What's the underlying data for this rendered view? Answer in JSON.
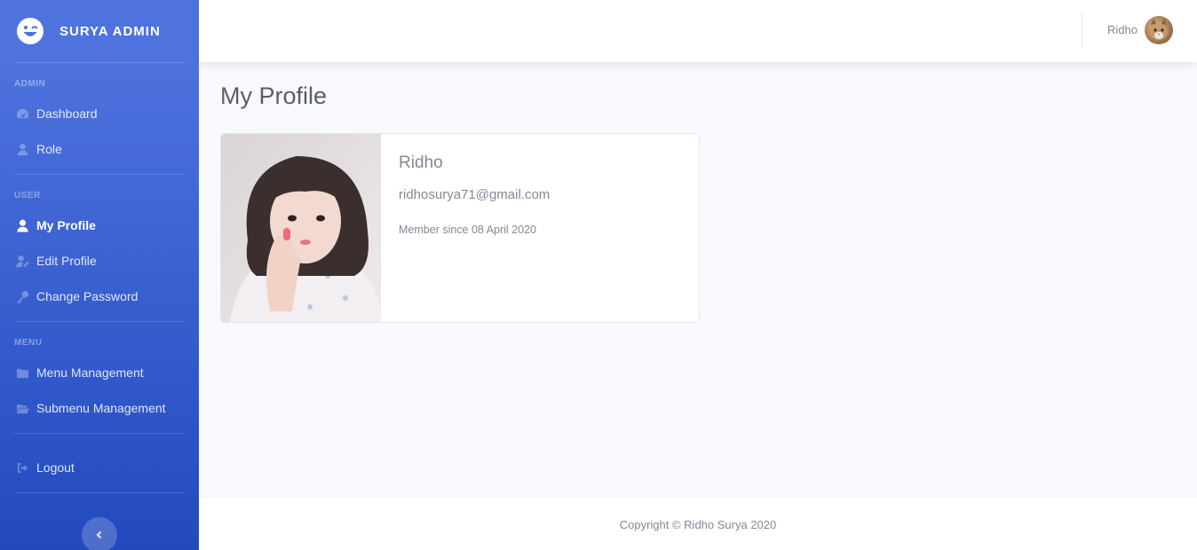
{
  "brand": {
    "name": "SURYA ADMIN",
    "icon": "laugh-wink-icon"
  },
  "sidebar": {
    "sections": [
      {
        "heading": "ADMIN",
        "items": [
          {
            "label": "Dashboard",
            "icon": "tachometer-icon"
          },
          {
            "label": "Role",
            "icon": "user-tie-icon"
          }
        ]
      },
      {
        "heading": "USER",
        "items": [
          {
            "label": "My Profile",
            "icon": "user-icon",
            "active": true
          },
          {
            "label": "Edit Profile",
            "icon": "user-edit-icon"
          },
          {
            "label": "Change Password",
            "icon": "key-icon"
          }
        ]
      },
      {
        "heading": "MENU",
        "items": [
          {
            "label": "Menu Management",
            "icon": "folder-icon"
          },
          {
            "label": "Submenu Management",
            "icon": "folder-open-icon"
          }
        ]
      }
    ],
    "logout": {
      "label": "Logout",
      "icon": "sign-out-icon"
    },
    "toggle_icon": "chevron-left-icon"
  },
  "topbar": {
    "user_name": "Ridho"
  },
  "page": {
    "title": "My Profile"
  },
  "profile": {
    "name": "Ridho",
    "email": "ridhosurya71@gmail.com",
    "member_since": "Member since 08 April 2020"
  },
  "footer": {
    "text": "Copyright © Ridho Surya 2020"
  },
  "colors": {
    "primary": "#4e73df",
    "primary_dark": "#224abe",
    "text_muted": "#858796",
    "title": "#5a5c69"
  }
}
